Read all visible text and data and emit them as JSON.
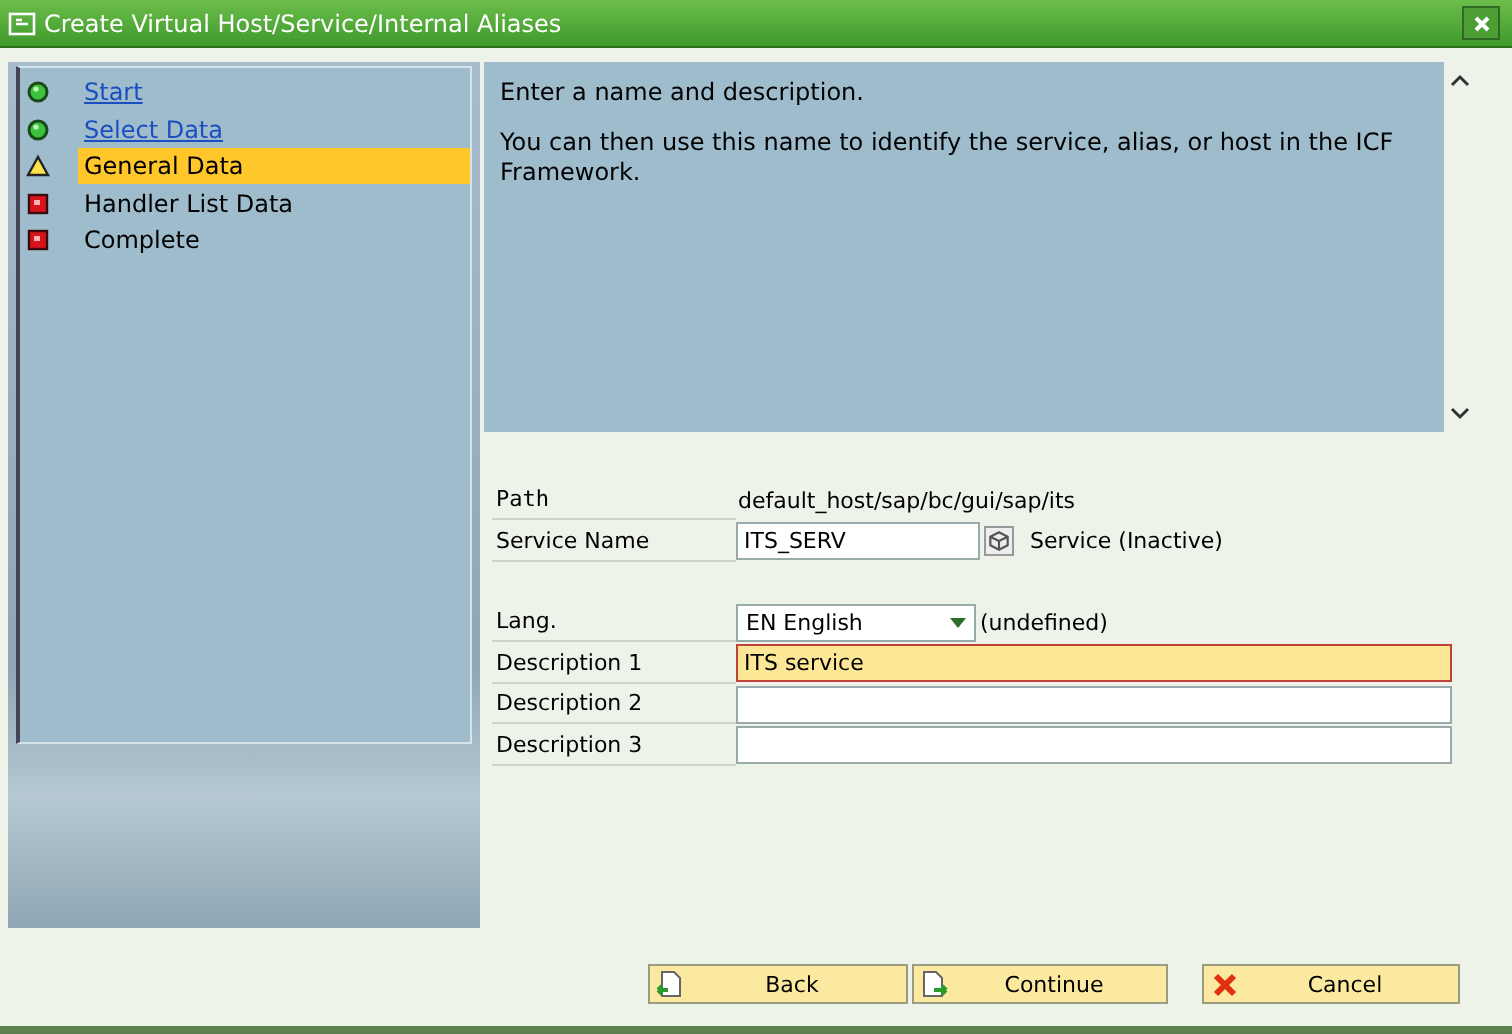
{
  "window": {
    "title": "Create Virtual Host/Service/Internal Aliases"
  },
  "steps": [
    {
      "label": "Start",
      "kind": "done",
      "selected": false
    },
    {
      "label": "Select Data",
      "kind": "done",
      "selected": false
    },
    {
      "label": "General Data",
      "kind": "current",
      "selected": true
    },
    {
      "label": "Handler List Data",
      "kind": "pending",
      "selected": false
    },
    {
      "label": "Complete",
      "kind": "pending",
      "selected": false
    }
  ],
  "info": {
    "lines": [
      "Enter a name and description.",
      "You can then use this name to identify the service, alias, or host in the ICF Framework."
    ]
  },
  "form": {
    "path": {
      "label": "Path",
      "value": "default_host/sap/bc/gui/sap/its"
    },
    "service_name": {
      "label": "Service Name",
      "value": "ITS_SERV",
      "status": "Service (Inactive)"
    },
    "lang": {
      "label": "Lang.",
      "value": "EN English",
      "note": "(undefined)"
    },
    "descriptions": [
      {
        "label": "Description 1",
        "value": "ITS service",
        "focused": true
      },
      {
        "label": "Description 2",
        "focused": false
      },
      {
        "label": "Description 3",
        "focused": false
      }
    ]
  },
  "buttons": [
    {
      "label": "Back",
      "kind": "back"
    },
    {
      "label": "Continue",
      "kind": "continue"
    },
    {
      "label": "Cancel",
      "kind": "cancel"
    }
  ]
}
